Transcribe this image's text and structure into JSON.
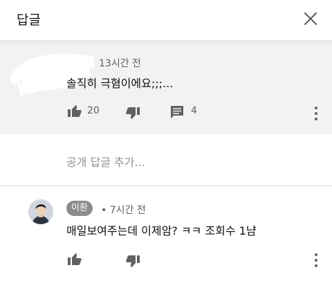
{
  "header": {
    "title": "답글"
  },
  "parent_comment": {
    "time": "13시간 전",
    "text": "솔직히 극혐이에요;;;...",
    "like_count": "20",
    "reply_count": "4"
  },
  "reply_input": {
    "placeholder": "공개 답글 추가..."
  },
  "reply": {
    "author": "이환",
    "time": "• 7시간 전",
    "text": "매일보여주는데 이제암? ㅋㅋ 조회수 1냠"
  },
  "colors": {
    "panel": "#f2f2f2",
    "text": "#0f0f0f",
    "muted": "#606060",
    "placeholder": "#909090",
    "badge": "#8c8c8c"
  },
  "icons": [
    "close-icon",
    "thumbs-up-icon",
    "thumbs-down-icon",
    "comment-icon",
    "more-vert-icon"
  ]
}
